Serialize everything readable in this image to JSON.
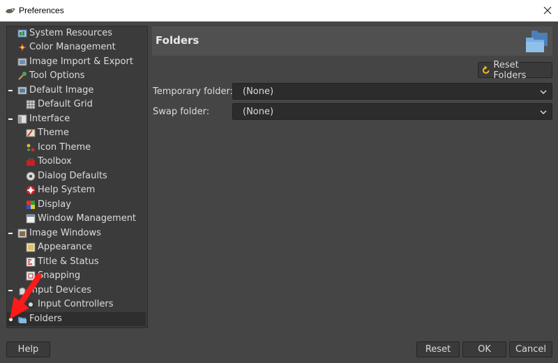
{
  "window": {
    "title": "Preferences",
    "icon": "gimp-wilber-icon",
    "close_icon": "close-icon"
  },
  "tree": {
    "items": [
      {
        "label": "System Resources",
        "level": 1,
        "expander": "",
        "icon": "system-resources-icon"
      },
      {
        "label": "Color Management",
        "level": 1,
        "expander": "",
        "icon": "color-management-icon"
      },
      {
        "label": "Image Import & Export",
        "level": 1,
        "expander": "",
        "icon": "image-import-export-icon"
      },
      {
        "label": "Tool Options",
        "level": 1,
        "expander": "",
        "icon": "tool-options-icon"
      },
      {
        "label": "Default Image",
        "level": 1,
        "expander": "minus",
        "icon": "default-image-icon"
      },
      {
        "label": "Default Grid",
        "level": 2,
        "expander": "",
        "icon": "default-grid-icon"
      },
      {
        "label": "Interface",
        "level": 1,
        "expander": "minus",
        "icon": "interface-icon"
      },
      {
        "label": "Theme",
        "level": 2,
        "expander": "",
        "icon": "theme-icon"
      },
      {
        "label": "Icon Theme",
        "level": 2,
        "expander": "",
        "icon": "icon-theme-icon"
      },
      {
        "label": "Toolbox",
        "level": 2,
        "expander": "",
        "icon": "toolbox-icon"
      },
      {
        "label": "Dialog Defaults",
        "level": 2,
        "expander": "",
        "icon": "dialog-defaults-icon"
      },
      {
        "label": "Help System",
        "level": 2,
        "expander": "",
        "icon": "help-system-icon"
      },
      {
        "label": "Display",
        "level": 2,
        "expander": "",
        "icon": "display-icon"
      },
      {
        "label": "Window Management",
        "level": 2,
        "expander": "",
        "icon": "window-management-icon"
      },
      {
        "label": "Image Windows",
        "level": 1,
        "expander": "minus",
        "icon": "image-windows-icon"
      },
      {
        "label": "Appearance",
        "level": 2,
        "expander": "",
        "icon": "appearance-icon"
      },
      {
        "label": "Title & Status",
        "level": 2,
        "expander": "",
        "icon": "title-status-icon"
      },
      {
        "label": "Snapping",
        "level": 2,
        "expander": "",
        "icon": "snapping-icon"
      },
      {
        "label": "Input Devices",
        "level": 1,
        "expander": "minus",
        "icon": "input-devices-icon"
      },
      {
        "label": "Input Controllers",
        "level": 2,
        "expander": "",
        "icon": "input-controllers-icon"
      },
      {
        "label": "Folders",
        "level": 1,
        "expander": "dot",
        "icon": "folders-icon",
        "selected": true
      }
    ]
  },
  "content": {
    "title": "Folders",
    "icon": "folders-icon",
    "reset_folders_label": "Reset Folders",
    "rows": [
      {
        "label": "Temporary folder:",
        "value": "(None)"
      },
      {
        "label": "Swap folder:",
        "value": "(None)"
      }
    ]
  },
  "footer": {
    "help": "Help",
    "reset": "Reset",
    "ok": "OK",
    "cancel": "Cancel"
  },
  "colors": {
    "background": "#454545",
    "panel": "#3b3b3b",
    "header": "#505050",
    "annotation_arrow": "#ff1a1a"
  }
}
